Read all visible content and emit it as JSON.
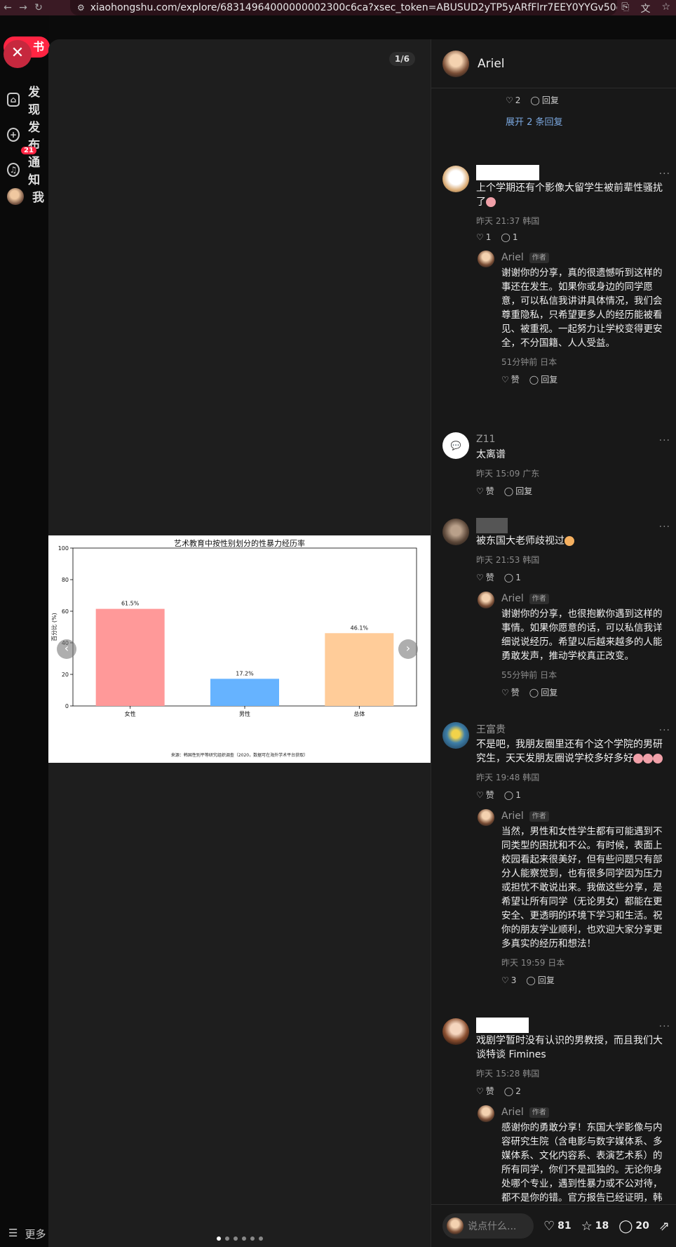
{
  "browser": {
    "url": "xiaohongshu.com/explore/68314964000000002300c6ca?xsec_token=ABUSUD2yTP5yARfFlrr7EEY0YYGv50qiuqbT-gR...",
    "back_icon": "arrow-left-icon",
    "forward_icon": "arrow-right-icon",
    "reload_icon": "reload-icon"
  },
  "sidebar": {
    "logo_text": "书",
    "items": [
      {
        "label": "发现",
        "icon": "home-icon"
      },
      {
        "label": "发布",
        "icon": "plus-icon"
      },
      {
        "label": "通知",
        "icon": "bell-icon",
        "badge": "21"
      },
      {
        "label": "我",
        "icon": "avatar"
      }
    ],
    "more_label": "更多"
  },
  "media": {
    "page_counter": "1/6",
    "dots_total": 6,
    "dots_active": 0
  },
  "chart_data": {
    "type": "bar",
    "title": "艺术教育中按性别划分的性暴力经历率",
    "categories": [
      "女性",
      "男性",
      "总体"
    ],
    "values": [
      61.5,
      17.2,
      46.1
    ],
    "value_labels": [
      "61.5%",
      "17.2%",
      "46.1%"
    ],
    "colors": [
      "#ff9999",
      "#66b3ff",
      "#ffcc99"
    ],
    "ylabel": "百分比 (%)",
    "xlabel": "",
    "ylim": [
      0,
      100
    ],
    "yticks": [
      0,
      20,
      40,
      60,
      80,
      100
    ],
    "source": "来源：韩国性别平等研究组织调查（2020，数据可在海外学术平台获取）"
  },
  "panel": {
    "author": "Ariel",
    "footer": {
      "placeholder": "说点什么...",
      "likes": "81",
      "stars": "18",
      "comments": "20"
    }
  },
  "comments": {
    "c0": {
      "likes": "2",
      "reply_label": "回复",
      "expand": "展开 2 条回复"
    },
    "c1": {
      "text": "上个学期还有个影像大留学生被前辈性骚扰了",
      "meta": "昨天 21:37 韩国",
      "likes": "1",
      "replies": "1",
      "reply": {
        "name": "Ariel",
        "tag": "作者",
        "text": "谢谢你的分享，真的很遗憾听到这样的事还在发生。如果你或身边的同学愿意，可以私信我讲讲具体情况，我们会尊重隐私，只希望更多人的经历能被看见、被重视。一起努力让学校变得更安全，不分国籍、人人受益。",
        "meta": "51分钟前 日本",
        "like_label": "赞",
        "reply_label": "回复"
      }
    },
    "c2": {
      "name": "Z11",
      "text": "太离谱",
      "meta": "昨天 15:09 广东",
      "like_label": "赞",
      "reply_label": "回复"
    },
    "c3": {
      "text": "被东国大老师歧视过",
      "meta": "昨天 21:53 韩国",
      "like_label": "赞",
      "replies": "1",
      "reply": {
        "name": "Ariel",
        "tag": "作者",
        "text": "谢谢你的分享，也很抱歉你遇到这样的事情。如果你愿意的话，可以私信我详细说说经历。希望以后越来越多的人能勇敢发声，推动学校真正改变。",
        "meta": "55分钟前 日本",
        "like_label": "赞",
        "reply_label": "回复"
      }
    },
    "c4": {
      "name": "王富贵",
      "text": "不是吧，我朋友圈里还有个这个学院的男研究生，天天发朋友圈说学校多好多好",
      "meta": "昨天 19:48 韩国",
      "like_label": "赞",
      "replies": "1",
      "reply": {
        "name": "Ariel",
        "tag": "作者",
        "text": "当然，男性和女性学生都有可能遇到不同类型的困扰和不公。有时候，表面上校园看起来很美好，但有些问题只有部分人能察觉到，也有很多同学因为压力或担忧不敢说出来。我做这些分享，是希望让所有同学（无论男女）都能在更安全、更透明的环境下学习和生活。祝你的朋友学业顺利，也欢迎大家分享更多真实的经历和想法！",
        "meta": "昨天 19:59 日本",
        "likes": "3",
        "reply_label": "回复"
      }
    },
    "c5": {
      "text": "戏剧学暂时没有认识的男教授，而且我们大谈特谈 Fimines",
      "meta": "昨天 15:28 韩国",
      "like_label": "赞",
      "replies": "2",
      "reply": {
        "name": "Ariel",
        "tag": "作者",
        "text": "感谢你的勇敢分享！东国大学影像与内容研究生院（含电影与数字媒体系、多媒体系、文化内容系、表演艺术系）的所有同学，你们不是孤独的。无论你身处哪个专业，遇到性暴力或不公对待，都不是你的错。官方报告已经证明，韩国艺术院校中女性学生面临极高的性暴力风险。你的声音很重要，我们会继续关注，支持并传递这些声音，希望你们"
      }
    }
  }
}
